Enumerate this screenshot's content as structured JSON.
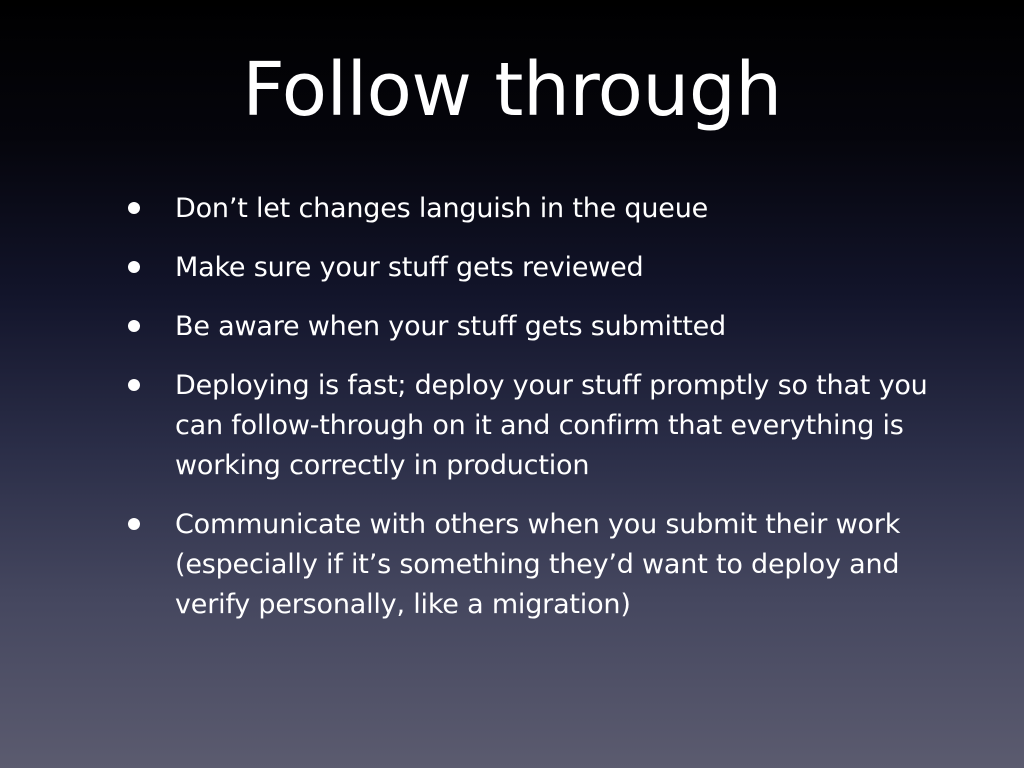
{
  "slide": {
    "title": "Follow through",
    "bullets": [
      "Don’t let changes languish in the queue",
      "Make sure your stuff gets reviewed",
      "Be aware when your stuff gets submitted",
      "Deploying is fast; deploy your stuff promptly so that you can follow-through on it and confirm that everything is working correctly in production",
      "Communicate with others when you submit their work (especially if it’s something they’d want to deploy and verify personally, like a migration)"
    ]
  },
  "colors": {
    "text": "#ffffff",
    "background_top": "#000000",
    "background_bottom": "#5b5b6f"
  }
}
